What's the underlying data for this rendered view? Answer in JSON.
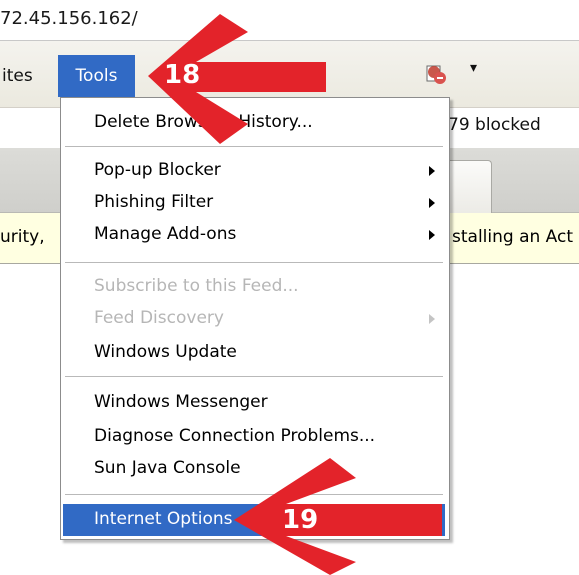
{
  "address_bar": {
    "url": "72.45.156.162/"
  },
  "menubar": {
    "items": [
      {
        "label": "ites"
      },
      {
        "label": "Tools"
      }
    ]
  },
  "toolbar": {
    "blocked_label": "79 blocked"
  },
  "infobar": {
    "left_text": "urity,",
    "right_text": "stalling an Act"
  },
  "tools_menu": {
    "items": [
      {
        "label": "Delete Browsing History..."
      },
      {
        "label": "Pop-up Blocker"
      },
      {
        "label": "Phishing Filter"
      },
      {
        "label": "Manage Add-ons"
      },
      {
        "label": "Subscribe to this Feed..."
      },
      {
        "label": "Feed Discovery"
      },
      {
        "label": "Windows Update"
      },
      {
        "label": "Windows Messenger"
      },
      {
        "label": "Diagnose Connection Problems..."
      },
      {
        "label": "Sun Java Console"
      },
      {
        "label": "Internet Options"
      }
    ]
  },
  "annotations": {
    "step_a": "18",
    "step_b": "19"
  },
  "colors": {
    "arrow": "#e3232a",
    "selection": "#316ac5"
  }
}
